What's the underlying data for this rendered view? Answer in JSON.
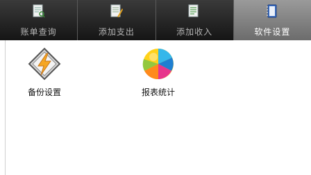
{
  "tabs": [
    {
      "label": "账单查询",
      "icon": "ledger-search-icon",
      "active": false
    },
    {
      "label": "添加支出",
      "icon": "add-expense-icon",
      "active": false
    },
    {
      "label": "添加收入",
      "icon": "add-income-icon",
      "active": false
    },
    {
      "label": "软件设置",
      "icon": "settings-book-icon",
      "active": true
    }
  ],
  "apps": [
    {
      "label": "备份设置",
      "icon": "lightning-diamond-icon"
    },
    {
      "label": "报表统计",
      "icon": "pie-chart-icon"
    }
  ],
  "colors": {
    "tab_bar": "#1a1a1a",
    "tab_active": "#7e7e7e",
    "tab_label": "#b4b4b4",
    "tab_label_active": "#ffffff"
  }
}
